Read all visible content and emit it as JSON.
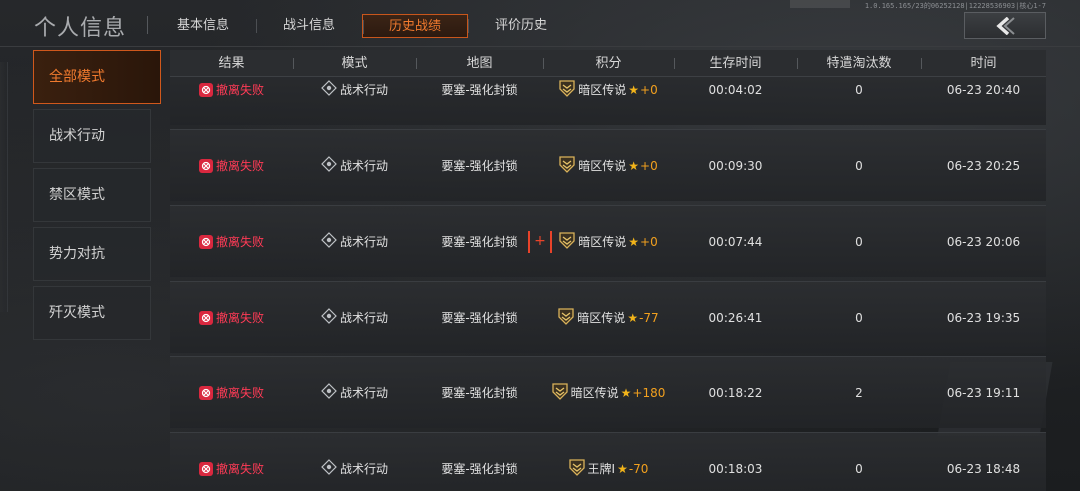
{
  "header": {
    "title": "个人信息",
    "tabs": [
      {
        "label": "基本信息",
        "active": false
      },
      {
        "label": "战斗信息",
        "active": false
      },
      {
        "label": "历史战绩",
        "active": true
      },
      {
        "label": "评价历史",
        "active": false
      }
    ],
    "build_info": "1.0.165.165/23的06252128|12228536903|核心1-7",
    "back_icon": "back-arrow-icon"
  },
  "sidebar": {
    "items": [
      {
        "label": "全部模式",
        "active": true
      },
      {
        "label": "战术行动",
        "active": false
      },
      {
        "label": "禁区模式",
        "active": false
      },
      {
        "label": "势力对抗",
        "active": false
      },
      {
        "label": "歼灭模式",
        "active": false
      }
    ]
  },
  "table": {
    "columns": [
      "结果",
      "模式",
      "地图",
      "积分",
      "生存时间",
      "特遣淘汰数",
      "时间"
    ],
    "rows": [
      {
        "result": "撤离失败",
        "mode": "战术行动",
        "map": "要塞-强化封锁",
        "rank": "暗区传说",
        "delta": "+0",
        "survival": "00:04:02",
        "kills": "0",
        "time": "06-23 20:40"
      },
      {
        "result": "撤离失败",
        "mode": "战术行动",
        "map": "要塞-强化封锁",
        "rank": "暗区传说",
        "delta": "+0",
        "survival": "00:09:30",
        "kills": "0",
        "time": "06-23 20:25"
      },
      {
        "result": "撤离失败",
        "mode": "战术行动",
        "map": "要塞-强化封锁",
        "rank": "暗区传说",
        "delta": "+0",
        "survival": "00:07:44",
        "kills": "0",
        "time": "06-23 20:06"
      },
      {
        "result": "撤离失败",
        "mode": "战术行动",
        "map": "要塞-强化封锁",
        "rank": "暗区传说",
        "delta": "-77",
        "survival": "00:26:41",
        "kills": "0",
        "time": "06-23 19:35"
      },
      {
        "result": "撤离失败",
        "mode": "战术行动",
        "map": "要塞-强化封锁",
        "rank": "暗区传说",
        "delta": "+180",
        "survival": "00:18:22",
        "kills": "2",
        "time": "06-23 19:11"
      },
      {
        "result": "撤离失败",
        "mode": "战术行动",
        "map": "要塞-强化封锁",
        "rank": "王牌I",
        "delta": "-70",
        "survival": "00:18:03",
        "kills": "0",
        "time": "06-23 18:48"
      }
    ],
    "expand_marker": "+"
  },
  "colors": {
    "accent": "#f07a2e",
    "fail": "#ff3b56",
    "score": "#f2a01e"
  }
}
